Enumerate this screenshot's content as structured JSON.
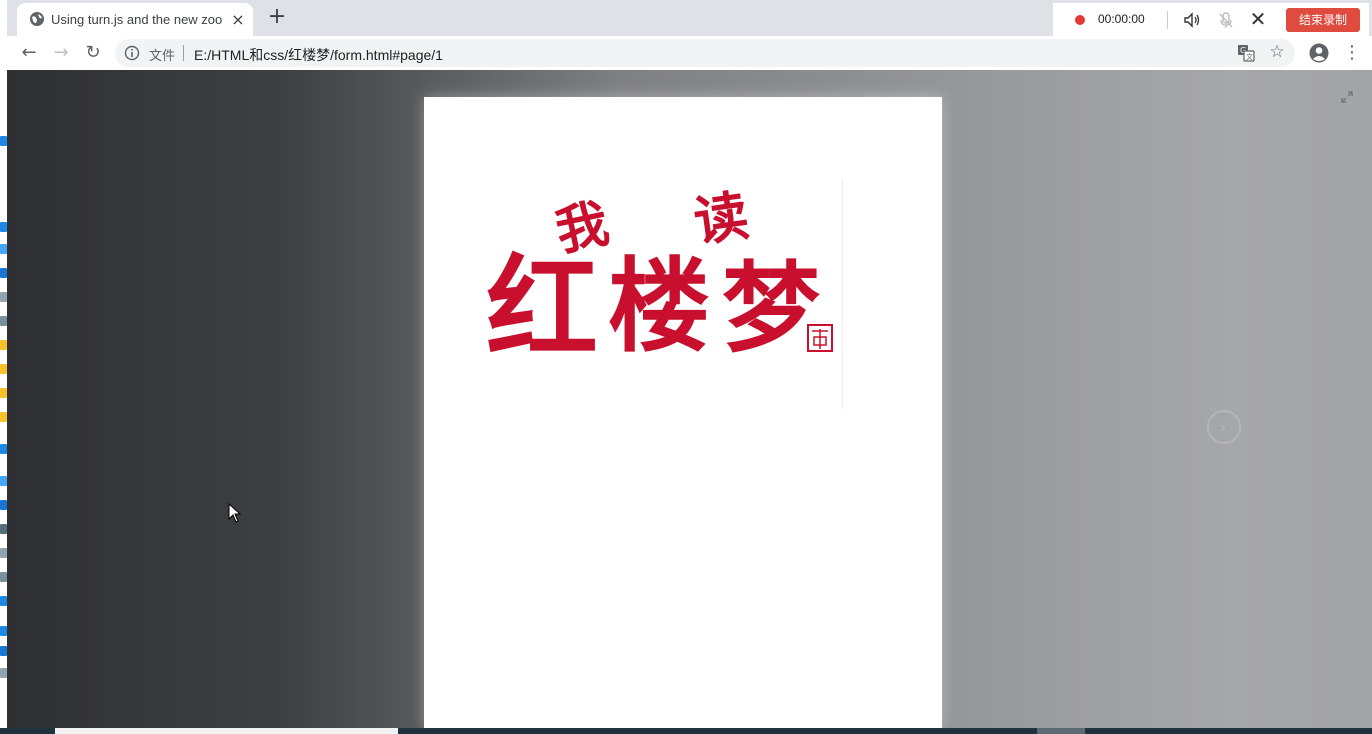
{
  "browser": {
    "tab": {
      "title": "Using turn.js and the new zoom",
      "icon": "globe-icon",
      "close_icon": "close-icon"
    },
    "new_tab_glyph": "+",
    "toolbar": {
      "back_glyph": "←",
      "forward_glyph": "→",
      "reload_glyph": "↻",
      "site_label": "文件",
      "url": "E:/HTML和css/红楼梦/form.html#page/1",
      "bookmark_glyph": "☆",
      "menu_glyph": "⋮"
    }
  },
  "recorder": {
    "time": "00:00:00",
    "close_glyph": "✕",
    "stop_label": "结束录制",
    "colors": {
      "dot": "#e53935",
      "button": "#e04b3f"
    }
  },
  "book": {
    "logo_title": "我读红楼梦",
    "logo_color": "#c8102e",
    "next_glyph": "›"
  }
}
